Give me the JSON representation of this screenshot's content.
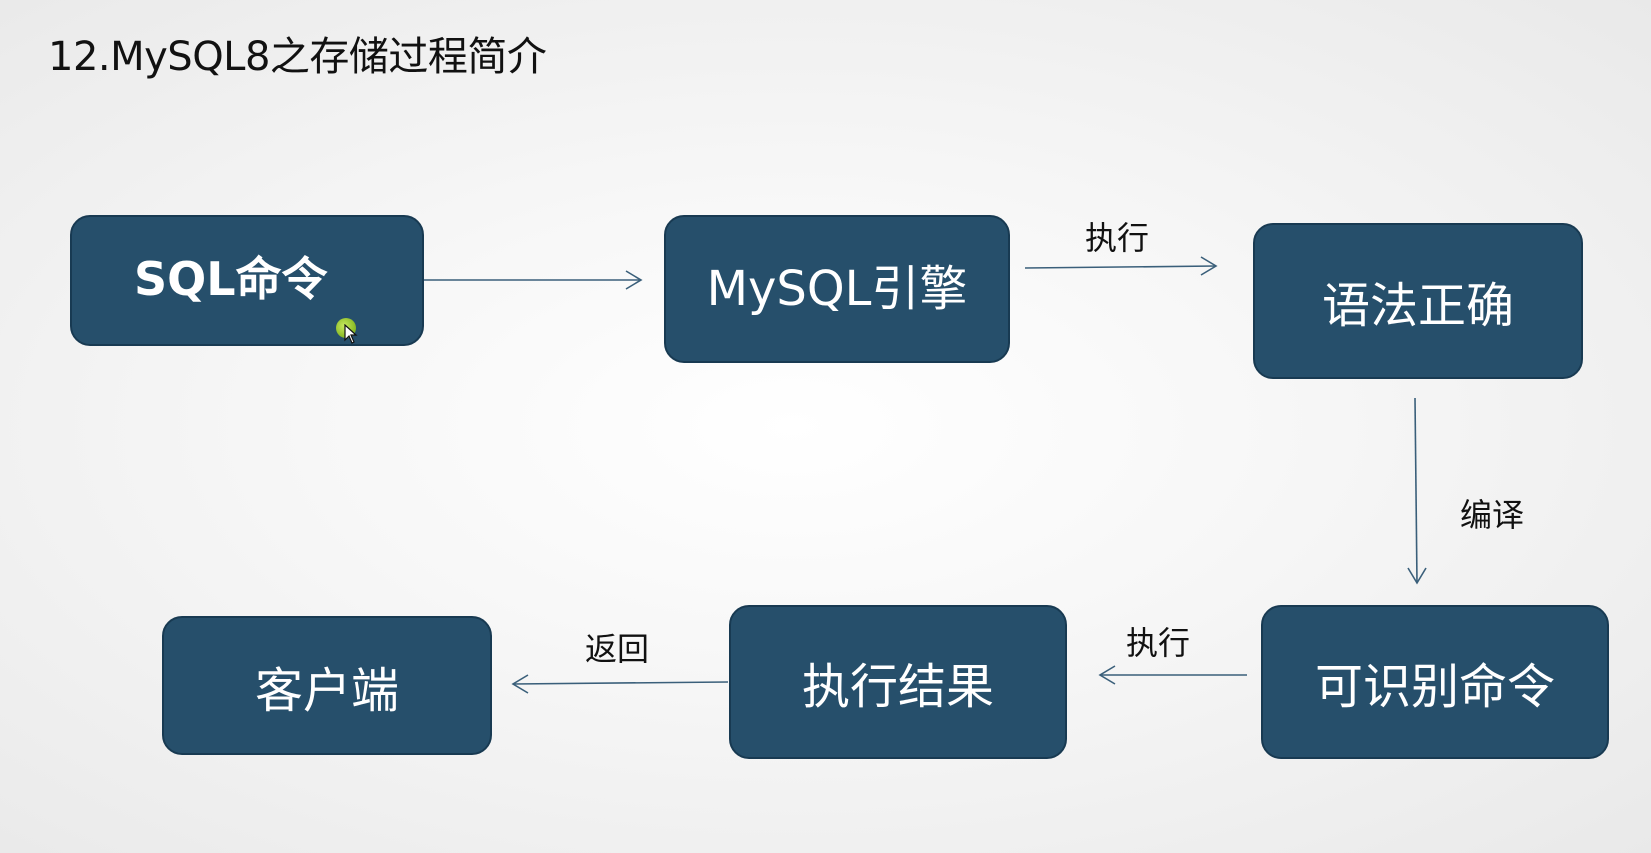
{
  "title": "12.MySQL8之存储过程简介",
  "nodes": {
    "sql_command": "SQL命令",
    "mysql_engine": "MySQL引擎",
    "syntax_correct": "语法正确",
    "recognizable_command": "可识别命令",
    "execution_result": "执行结果",
    "client": "客户端"
  },
  "edges": {
    "execute_top": "执行",
    "compile": "编译",
    "execute_bottom": "执行",
    "return": "返回"
  },
  "colors": {
    "box_fill": "#264f6b",
    "box_border": "#183a52",
    "connector": "#3a5f7a",
    "text_on_box": "#ffffff"
  }
}
